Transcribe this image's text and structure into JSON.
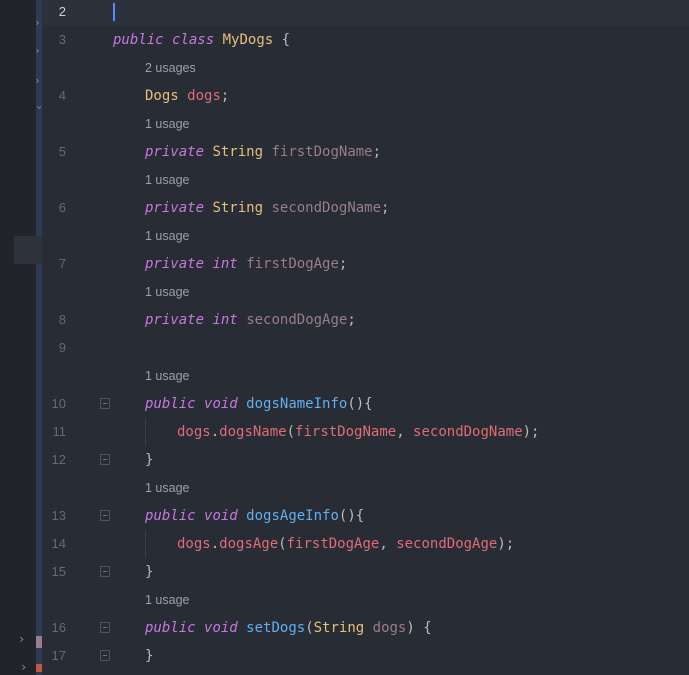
{
  "editor": {
    "line_numbers": [
      "2",
      "3",
      "4",
      "5",
      "6",
      "7",
      "8",
      "9",
      "10",
      "11",
      "12",
      "13",
      "14",
      "15",
      "16",
      "17"
    ],
    "usages": {
      "u1": "2 usages",
      "u2": "1 usage",
      "u3": "1 usage",
      "u4": "1 usage",
      "u5": "1 usage",
      "u6": "1 usage",
      "u7": "1 usage",
      "u8": "1 usage"
    },
    "tokens": {
      "kw_public": "public",
      "kw_class": "class",
      "class_name": "MyDogs",
      "brace_open": " {",
      "type_dogs": "Dogs",
      "field_dogs": "dogs",
      "semicolon": ";",
      "kw_private": "private",
      "type_string": "String",
      "kw_int": "int",
      "field_firstDogName": "firstDogName",
      "field_secondDogName": "secondDogName",
      "field_firstDogAge": "firstDogAge",
      "field_secondDogAge": "secondDogAge",
      "kw_void": "void",
      "fn_dogsNameInfo": "dogsNameInfo",
      "fn_dogsAgeInfo": "dogsAgeInfo",
      "fn_setDogs": "setDogs",
      "fn_dogsName": "dogsName",
      "fn_dogsAge": "dogsAge",
      "parens_brace": "(){",
      "dot": ".",
      "open_paren": "(",
      "comma": ", ",
      "close_stmt": ");",
      "close_brace": "}",
      "param_string": "String",
      "param_dogs": "dogs",
      "close_paren_brace": ") {"
    }
  },
  "colors": {
    "background": "#282c34",
    "keyword": "#c678dd",
    "type": "#e5c07b",
    "field": "#e06c75",
    "function": "#61afef",
    "usage_hint": "#9aa0aa",
    "caret": "#528bff"
  }
}
